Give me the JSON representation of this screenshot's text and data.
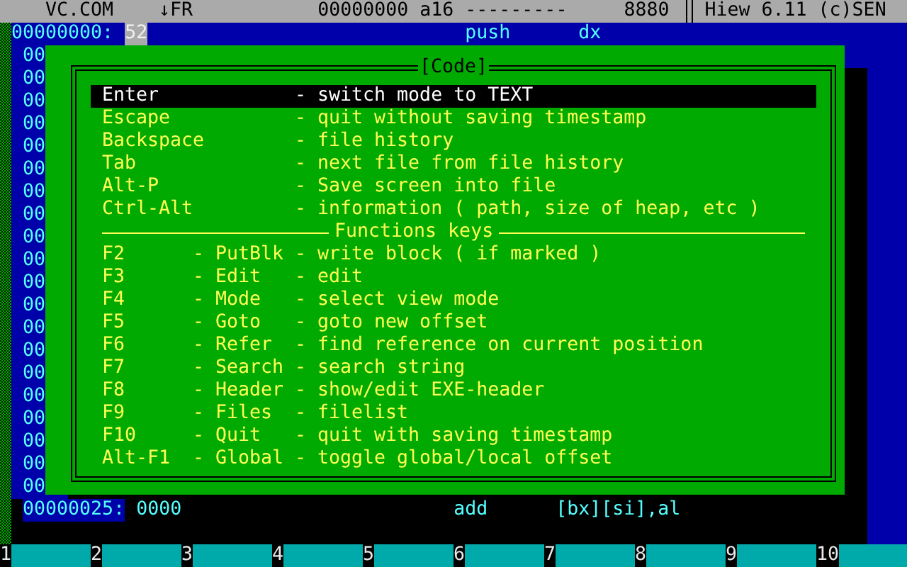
{
  "status_bar": {
    "file": "VC.COM",
    "mode": "↓FR",
    "offset": "00000000 a16 ---------",
    "segment": "8880",
    "title": "Hiew 6.11 (c)SEN"
  },
  "code_view": {
    "top_line": {
      "address": "00000000:",
      "cursor_byte": "52",
      "mnemonic": "push",
      "operand": "dx"
    },
    "gutter": [
      "00",
      "00",
      "00",
      "00",
      "00",
      "00",
      "00",
      "00",
      "00",
      "00",
      "00",
      "00",
      "00",
      "00",
      "00",
      "00",
      "00",
      "00",
      "00",
      "00"
    ],
    "bottom_line": {
      "address": "00000025:",
      "bytes": "0000",
      "mnemonic": "add",
      "operand": "[bx][si],al"
    }
  },
  "dialog": {
    "title": "[Code]",
    "items": [
      {
        "kind": "command",
        "key": "Enter",
        "description": "- switch mode to TEXT",
        "selected": true
      },
      {
        "kind": "command",
        "key": "Escape",
        "description": "- quit without saving timestamp",
        "selected": false
      },
      {
        "kind": "command",
        "key": "Backspace",
        "description": "- file history",
        "selected": false
      },
      {
        "kind": "command",
        "key": "Tab",
        "description": "- next file from file history",
        "selected": false
      },
      {
        "kind": "command",
        "key": "Alt-P",
        "description": "- Save screen into file",
        "selected": false
      },
      {
        "kind": "command",
        "key": "Ctrl-Alt",
        "description": "- information ( path, size of heap, etc )",
        "selected": false
      },
      {
        "kind": "separator",
        "label": "Functions keys"
      },
      {
        "kind": "function",
        "key": "F2",
        "name": "- PutBlk",
        "description": "- write block ( if marked )",
        "selected": false
      },
      {
        "kind": "function",
        "key": "F3",
        "name": "- Edit",
        "description": "- edit",
        "selected": false
      },
      {
        "kind": "function",
        "key": "F4",
        "name": "- Mode",
        "description": "- select view mode",
        "selected": false
      },
      {
        "kind": "function",
        "key": "F5",
        "name": "- Goto",
        "description": "- goto new offset",
        "selected": false
      },
      {
        "kind": "function",
        "key": "F6",
        "name": "- Refer",
        "description": "- find reference on current position",
        "selected": false
      },
      {
        "kind": "function",
        "key": "F7",
        "name": "- Search",
        "description": "- search string",
        "selected": false
      },
      {
        "kind": "function",
        "key": "F8",
        "name": "- Header",
        "description": "- show/edit EXE-header",
        "selected": false
      },
      {
        "kind": "function",
        "key": "F9",
        "name": "- Files",
        "description": "- filelist",
        "selected": false
      },
      {
        "kind": "function",
        "key": "F10",
        "name": "- Quit",
        "description": "- quit with saving timestamp",
        "selected": false
      },
      {
        "kind": "function",
        "key": "Alt-F1",
        "name": "- Global",
        "description": "- toggle global/local offset",
        "selected": false
      }
    ]
  },
  "key_bar": [
    {
      "number": "1"
    },
    {
      "number": "2"
    },
    {
      "number": "3"
    },
    {
      "number": "4"
    },
    {
      "number": "5"
    },
    {
      "number": "6"
    },
    {
      "number": "7"
    },
    {
      "number": "8"
    },
    {
      "number": "9"
    },
    {
      "number": "10"
    }
  ]
}
